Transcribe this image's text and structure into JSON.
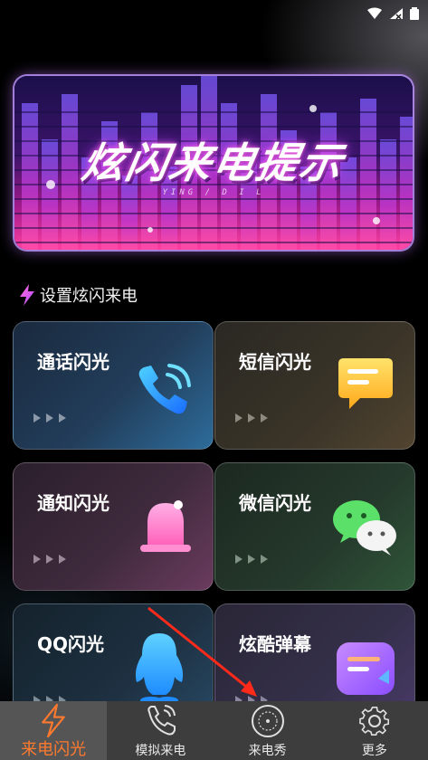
{
  "banner": {
    "title": "炫闪来电提示",
    "subtitle": "YING / D I L"
  },
  "section": {
    "title": "设置炫闪来电"
  },
  "cards": [
    {
      "label": "通话闪光",
      "icon": "phone-icon"
    },
    {
      "label": "短信闪光",
      "icon": "message-icon"
    },
    {
      "label": "通知闪光",
      "icon": "bell-icon"
    },
    {
      "label": "微信闪光",
      "icon": "wechat-icon"
    },
    {
      "label": "QQ闪光",
      "icon": "qq-icon"
    },
    {
      "label": "炫酷弹幕",
      "icon": "barrage-icon"
    }
  ],
  "tabs": [
    {
      "label": "来电闪光",
      "icon": "lightning-icon",
      "active": true
    },
    {
      "label": "模拟来电",
      "icon": "phone-call-icon",
      "active": false
    },
    {
      "label": "来电秀",
      "icon": "call-show-icon",
      "active": false
    },
    {
      "label": "更多",
      "icon": "gear-icon",
      "active": false
    }
  ],
  "colors": {
    "accent": "#ff7a2e",
    "tabbar": "#3d3d3d",
    "annotation": "#ff2a1a"
  }
}
